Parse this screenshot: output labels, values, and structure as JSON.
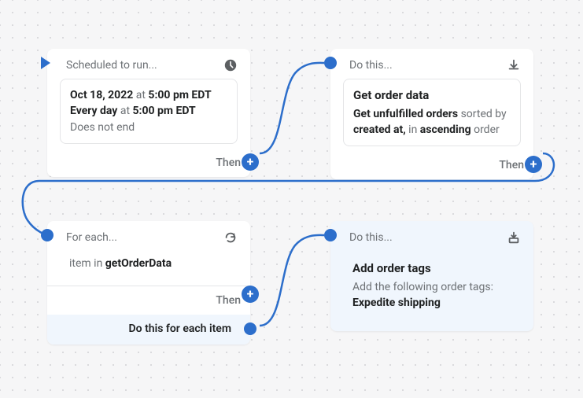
{
  "card1": {
    "header": "Scheduled to run...",
    "date": "Oct 18, 2022",
    "at1": " at ",
    "time1": "5:00 pm EDT",
    "every": "Every day",
    "at2": " at ",
    "time2": "5:00 pm EDT",
    "ends": "Does not end",
    "then": "Then"
  },
  "card2": {
    "header": "Do this...",
    "title": "Get order data",
    "line_get": "Get ",
    "line_unf": "unfulfilled orders",
    "line_sorted": " sorted by ",
    "line_created": "created at,",
    "line_in": " in ",
    "line_asc": "ascending",
    "line_order": " order",
    "then": "Then"
  },
  "card3": {
    "header": "For each...",
    "item_prefix": "item in ",
    "item_var": "getOrderData",
    "then": "Then",
    "foreach": "Do this for each item"
  },
  "card4": {
    "header": "Do this...",
    "title": "Add order tags",
    "sub": "Add the following order tags:",
    "tag": "Expedite shipping"
  }
}
